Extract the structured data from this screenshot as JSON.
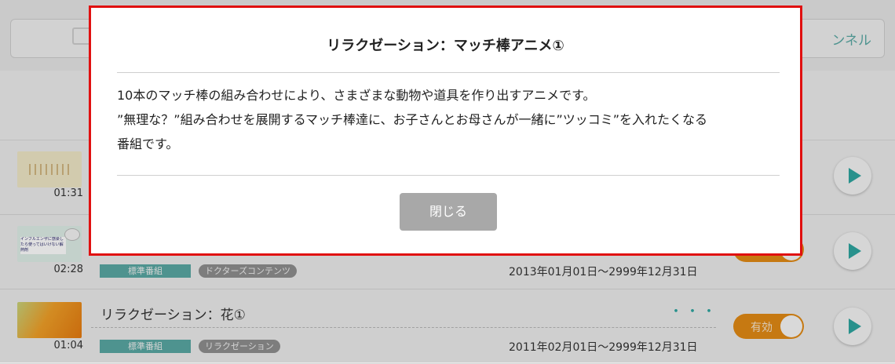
{
  "header": {
    "right_tab_label": "ンネル"
  },
  "rows": [
    {
      "duration": "01:31"
    },
    {
      "duration": "02:28",
      "thumbnail_text": "インフルエンザに感染したら使ってはいけない解熱剤",
      "tags": [
        "標準番組",
        "ドクターズコンテンツ"
      ],
      "period": "2013年01月01日〜2999年12月31日"
    },
    {
      "duration": "01:04",
      "title": "リラクゼーション：花①",
      "ellipsis": "・・・",
      "tags": [
        "標準番組",
        "リラクゼーション"
      ],
      "period": "2011年02月01日〜2999年12月31日",
      "toggle_label": "有効"
    }
  ],
  "modal": {
    "title": "リラクゼーション：マッチ棒アニメ①",
    "body_lines": [
      "10本のマッチ棒の組み合わせにより、さまざまな動物や道具を作り出すアニメです。",
      "”無理な？”組み合わせを展開するマッチ棒達に、お子さんとお母さんが一緒に”ツッコミ”を入れたくなる",
      "番組です。"
    ],
    "close_label": "閉じる"
  },
  "colors": {
    "accent": "#2ea6a0",
    "toggle_on": "#e28a15",
    "modal_border": "#e01010",
    "close_button": "#a8a8a8"
  }
}
